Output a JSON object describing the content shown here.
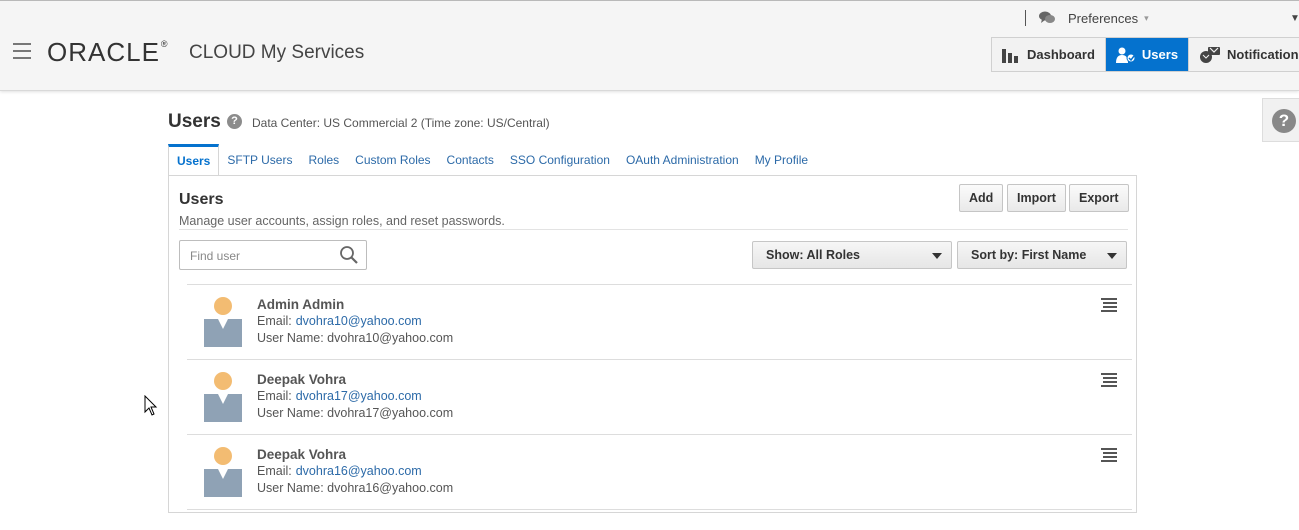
{
  "header": {
    "logo_text": "ORACLE",
    "logo_mark": "®",
    "title": "CLOUD My Services",
    "preferences_label": "Preferences",
    "nav": [
      {
        "label": "Dashboard",
        "icon": "bar-chart-icon"
      },
      {
        "label": "Users",
        "icon": "users-icon",
        "active": true
      },
      {
        "label": "Notifications",
        "icon": "notifications-icon"
      }
    ],
    "help_icon_glyph": "?"
  },
  "page": {
    "title": "Users",
    "help_glyph": "?",
    "datacenter_text": "Data Center: US Commercial 2 (Time zone: US/Central)"
  },
  "tabs": [
    {
      "label": "Users",
      "active": true
    },
    {
      "label": "SFTP Users"
    },
    {
      "label": "Roles"
    },
    {
      "label": "Custom Roles"
    },
    {
      "label": "Contacts"
    },
    {
      "label": "SSO Configuration"
    },
    {
      "label": "OAuth Administration"
    },
    {
      "label": "My Profile"
    }
  ],
  "panel": {
    "title": "Users",
    "description": "Manage user accounts, assign roles, and reset passwords.",
    "buttons": {
      "add": "Add",
      "import": "Import",
      "export": "Export"
    },
    "search": {
      "placeholder": "Find user",
      "value": ""
    },
    "show_filter": "Show: All Roles",
    "sort_filter": "Sort by: First Name"
  },
  "users": [
    {
      "name": "Admin Admin",
      "email_label": "Email:",
      "email": "dvohra10@yahoo.com",
      "username_label": "User Name:",
      "username": "dvohra10@yahoo.com"
    },
    {
      "name": "Deepak Vohra",
      "email_label": "Email:",
      "email": "dvohra17@yahoo.com",
      "username_label": "User Name:",
      "username": "dvohra17@yahoo.com"
    },
    {
      "name": "Deepak Vohra",
      "email_label": "Email:",
      "email": "dvohra16@yahoo.com",
      "username_label": "User Name:",
      "username": "dvohra16@yahoo.com"
    }
  ],
  "colors": {
    "accent": "#0572ce",
    "link": "#2c6aa8",
    "avatar_head": "#f3bc72",
    "avatar_body": "#8fa2b5"
  }
}
